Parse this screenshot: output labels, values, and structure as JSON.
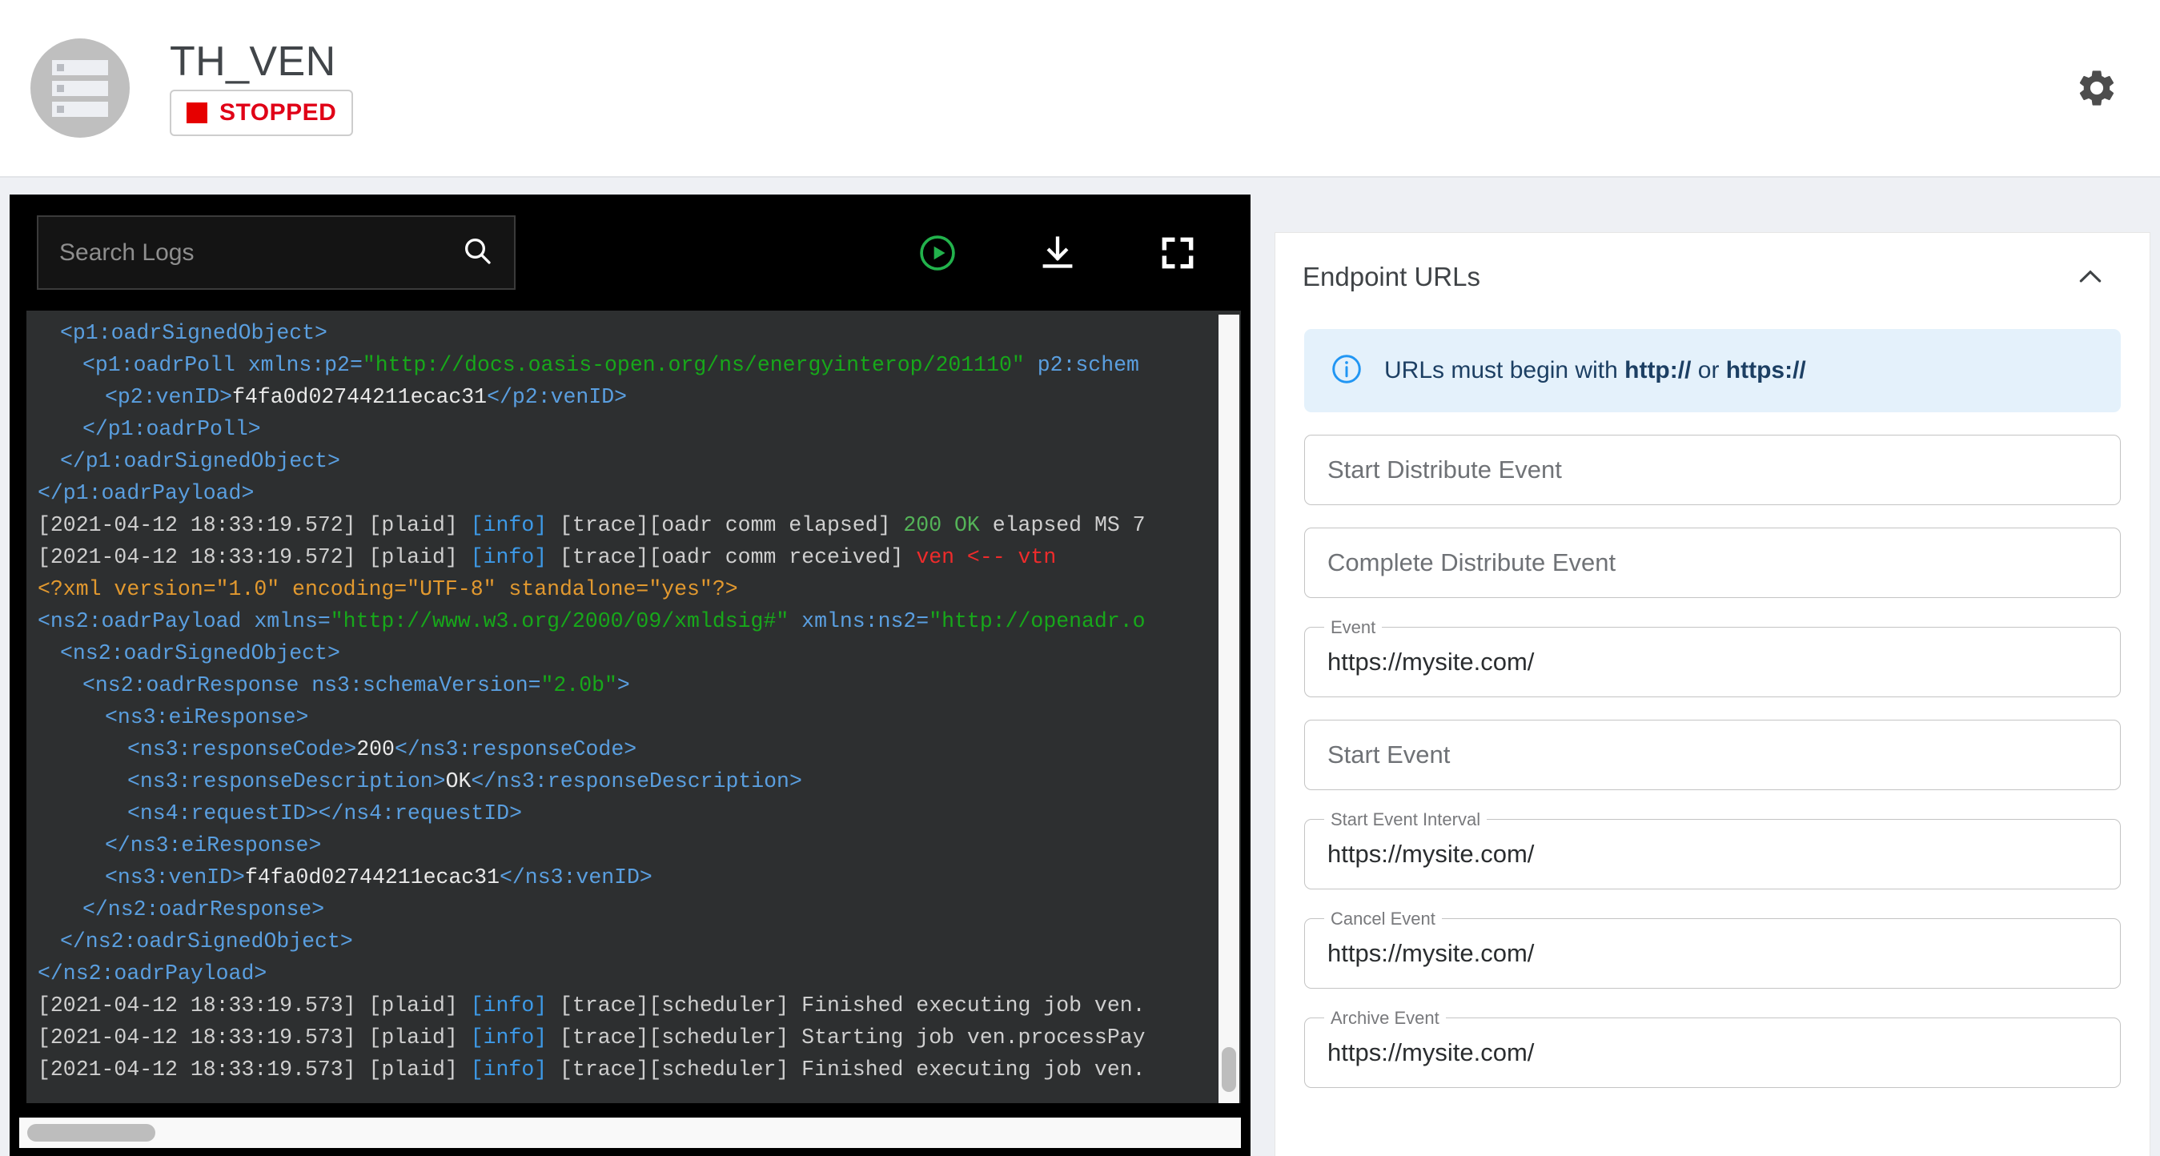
{
  "header": {
    "title": "TH_VEN",
    "status": "STOPPED",
    "status_color": "#e00016",
    "avatar_icon": "server-icon",
    "settings_icon": "gear-icon"
  },
  "log_panel": {
    "search": {
      "placeholder": "Search Logs",
      "value": "",
      "icon": "search-icon"
    },
    "toolbar_buttons": [
      {
        "name": "play-button",
        "icon": "play-circle-icon",
        "color": "#22b24c"
      },
      {
        "name": "download-button",
        "icon": "download-icon",
        "color": "#ffffff"
      },
      {
        "name": "fullscreen-button",
        "icon": "fullscreen-icon",
        "color": "#ffffff"
      },
      {
        "name": "close-button",
        "icon": "close-icon",
        "color": "#ffffff"
      }
    ],
    "lines": [
      {
        "indent": 1,
        "parts": [
          {
            "t": "<p1:oadrSignedObject>",
            "c": "c-tag"
          }
        ]
      },
      {
        "indent": 2,
        "parts": [
          {
            "t": "<p1:oadrPoll xmlns:p2=",
            "c": "c-tag"
          },
          {
            "t": "\"http://docs.oasis-open.org/ns/energyinterop/201110\"",
            "c": "c-str"
          },
          {
            "t": " p2:schem",
            "c": "c-tag"
          }
        ]
      },
      {
        "indent": 3,
        "parts": [
          {
            "t": "<p2:venID>",
            "c": "c-tag"
          },
          {
            "t": "f4fa0d02744211ecac31",
            "c": "c-txt"
          },
          {
            "t": "</p2:venID>",
            "c": "c-tag"
          }
        ]
      },
      {
        "indent": 2,
        "parts": [
          {
            "t": "</p1:oadrPoll>",
            "c": "c-tag"
          }
        ]
      },
      {
        "indent": 1,
        "parts": [
          {
            "t": "</p1:oadrSignedObject>",
            "c": "c-tag"
          }
        ]
      },
      {
        "indent": 0,
        "parts": [
          {
            "t": "</p1:oadrPayload>",
            "c": "c-tag"
          }
        ]
      },
      {
        "indent": 0,
        "parts": [
          {
            "t": "[2021-04-12 18:33:19.572] [plaid] ",
            "c": "c-dim"
          },
          {
            "t": "[info]",
            "c": "c-info"
          },
          {
            "t": " [trace][oadr comm elapsed] ",
            "c": "c-dim"
          },
          {
            "t": "200 OK",
            "c": "c-ok"
          },
          {
            "t": " elapsed MS 7",
            "c": "c-dim"
          }
        ]
      },
      {
        "indent": 0,
        "parts": [
          {
            "t": "[2021-04-12 18:33:19.572] [plaid] ",
            "c": "c-dim"
          },
          {
            "t": "[info]",
            "c": "c-info"
          },
          {
            "t": " [trace][oadr comm received] ",
            "c": "c-dim"
          },
          {
            "t": "ven <-- vtn",
            "c": "c-red"
          }
        ]
      },
      {
        "indent": 0,
        "parts": [
          {
            "t": "<?xml version=\"1.0\" encoding=\"UTF-8\" standalone=\"yes\"?>",
            "c": "c-proc"
          }
        ]
      },
      {
        "indent": 0,
        "parts": [
          {
            "t": "<ns2:oadrPayload xmlns=",
            "c": "c-tag"
          },
          {
            "t": "\"http://www.w3.org/2000/09/xmldsig#\"",
            "c": "c-str"
          },
          {
            "t": " xmlns:ns2=",
            "c": "c-tag"
          },
          {
            "t": "\"http://openadr.o",
            "c": "c-str"
          }
        ]
      },
      {
        "indent": 1,
        "parts": [
          {
            "t": "<ns2:oadrSignedObject>",
            "c": "c-tag"
          }
        ]
      },
      {
        "indent": 2,
        "parts": [
          {
            "t": "<ns2:oadrResponse ns3:schemaVersion=",
            "c": "c-tag"
          },
          {
            "t": "\"2.0b\"",
            "c": "c-str"
          },
          {
            "t": ">",
            "c": "c-tag"
          }
        ]
      },
      {
        "indent": 3,
        "parts": [
          {
            "t": "<ns3:eiResponse>",
            "c": "c-tag"
          }
        ]
      },
      {
        "indent": 4,
        "parts": [
          {
            "t": "<ns3:responseCode>",
            "c": "c-tag"
          },
          {
            "t": "200",
            "c": "c-txt"
          },
          {
            "t": "</ns3:responseCode>",
            "c": "c-tag"
          }
        ]
      },
      {
        "indent": 4,
        "parts": [
          {
            "t": "<ns3:responseDescription>",
            "c": "c-tag"
          },
          {
            "t": "OK",
            "c": "c-txt"
          },
          {
            "t": "</ns3:responseDescription>",
            "c": "c-tag"
          }
        ]
      },
      {
        "indent": 4,
        "parts": [
          {
            "t": "<ns4:requestID></ns4:requestID>",
            "c": "c-tag"
          }
        ]
      },
      {
        "indent": 3,
        "parts": [
          {
            "t": "</ns3:eiResponse>",
            "c": "c-tag"
          }
        ]
      },
      {
        "indent": 3,
        "parts": [
          {
            "t": "<ns3:venID>",
            "c": "c-tag"
          },
          {
            "t": "f4fa0d02744211ecac31",
            "c": "c-txt"
          },
          {
            "t": "</ns3:venID>",
            "c": "c-tag"
          }
        ]
      },
      {
        "indent": 2,
        "parts": [
          {
            "t": "</ns2:oadrResponse>",
            "c": "c-tag"
          }
        ]
      },
      {
        "indent": 1,
        "parts": [
          {
            "t": "</ns2:oadrSignedObject>",
            "c": "c-tag"
          }
        ]
      },
      {
        "indent": 0,
        "parts": [
          {
            "t": "</ns2:oadrPayload>",
            "c": "c-tag"
          }
        ]
      },
      {
        "indent": 0,
        "parts": [
          {
            "t": "[2021-04-12 18:33:19.573] [plaid] ",
            "c": "c-dim"
          },
          {
            "t": "[info]",
            "c": "c-info"
          },
          {
            "t": " [trace][scheduler] Finished executing job ven.",
            "c": "c-dim"
          }
        ]
      },
      {
        "indent": 0,
        "parts": [
          {
            "t": "[2021-04-12 18:33:19.573] [plaid] ",
            "c": "c-dim"
          },
          {
            "t": "[info]",
            "c": "c-info"
          },
          {
            "t": " [trace][scheduler] Starting job ven.processPay",
            "c": "c-dim"
          }
        ]
      },
      {
        "indent": 0,
        "parts": [
          {
            "t": "[2021-04-12 18:33:19.573] [plaid] ",
            "c": "c-dim"
          },
          {
            "t": "[info]",
            "c": "c-info"
          },
          {
            "t": " [trace][scheduler] Finished executing job ven.",
            "c": "c-dim"
          }
        ]
      }
    ]
  },
  "side_panel": {
    "title": "Endpoint URLs",
    "collapse_icon": "chevron-up-icon",
    "info": {
      "icon": "info-icon",
      "prefix": "URLs must begin with ",
      "scheme_http": "http://",
      "conjunction": " or ",
      "scheme_https": "https://"
    },
    "fields": [
      {
        "name": "start-distribute-event",
        "label": "Start Distribute Event",
        "value": "",
        "placeholder": "Start Distribute Event",
        "filled": false
      },
      {
        "name": "complete-distribute-event",
        "label": "Complete Distribute Event",
        "value": "",
        "placeholder": "Complete Distribute Event",
        "filled": false
      },
      {
        "name": "event",
        "label": "Event",
        "value": "https://mysite.com/",
        "placeholder": "Event",
        "filled": true
      },
      {
        "name": "start-event",
        "label": "Start Event",
        "value": "",
        "placeholder": "Start Event",
        "filled": false
      },
      {
        "name": "start-event-interval",
        "label": "Start Event Interval",
        "value": "https://mysite.com/",
        "placeholder": "Start Event Interval",
        "filled": true
      },
      {
        "name": "cancel-event",
        "label": "Cancel Event",
        "value": "https://mysite.com/",
        "placeholder": "Cancel Event",
        "filled": true
      },
      {
        "name": "archive-event",
        "label": "Archive Event",
        "value": "https://mysite.com/",
        "placeholder": "Archive Event",
        "filled": true
      }
    ]
  }
}
